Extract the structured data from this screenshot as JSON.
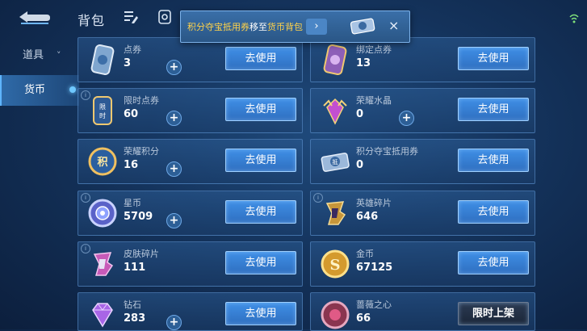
{
  "header": {
    "title": "背包"
  },
  "sidebar": {
    "items": [
      {
        "label": "道具",
        "chevron": "˅"
      },
      {
        "label": "货币"
      }
    ]
  },
  "toast": {
    "part1": "积分夺宝抵用券",
    "part2": "移至",
    "part3": "货币背包",
    "arrow": "›",
    "close": "×"
  },
  "items": [
    {
      "name": "点券",
      "count": "3",
      "action": "去使用",
      "icon": "coupon-card-icon",
      "plus": "+"
    },
    {
      "name": "绑定点券",
      "count": "13",
      "action": "去使用",
      "icon": "bound-coupon-card-icon",
      "plus": "+"
    },
    {
      "name": "限时点券",
      "count": "60",
      "action": "去使用",
      "icon": "limited-coupon-icon",
      "icon_text": "限时",
      "plus": "+"
    },
    {
      "name": "荣耀水晶",
      "count": "0",
      "action": "去使用",
      "icon": "glory-crystal-icon",
      "plus": "+"
    },
    {
      "name": "荣耀积分",
      "count": "16",
      "action": "去使用",
      "icon": "glory-points-icon",
      "icon_text": "积",
      "plus": "+"
    },
    {
      "name": "积分夺宝抵用券",
      "count": "0",
      "action": "去使用",
      "icon": "lottery-ticket-icon",
      "icon_text": "抵",
      "plus": ""
    },
    {
      "name": "星币",
      "count": "5709",
      "action": "去使用",
      "icon": "star-coin-icon",
      "plus": "+"
    },
    {
      "name": "英雄碎片",
      "count": "646",
      "action": "去使用",
      "icon": "hero-fragment-icon",
      "plus": "+"
    },
    {
      "name": "皮肤碎片",
      "count": "111",
      "action": "去使用",
      "icon": "skin-fragment-icon",
      "plus": "+"
    },
    {
      "name": "金币",
      "count": "67125",
      "action": "去使用",
      "icon": "gold-coin-icon",
      "icon_text": "S",
      "plus": "+"
    },
    {
      "name": "钻石",
      "count": "283",
      "action": "去使用",
      "icon": "diamond-icon",
      "plus": "+"
    },
    {
      "name": "蔷薇之心",
      "count": "66",
      "action": "限时上架",
      "icon": "rose-heart-icon",
      "plus": ""
    }
  ],
  "colors": {
    "accent": "#3f8fe6",
    "highlight": "#ffd24a",
    "background": "#14335c"
  }
}
